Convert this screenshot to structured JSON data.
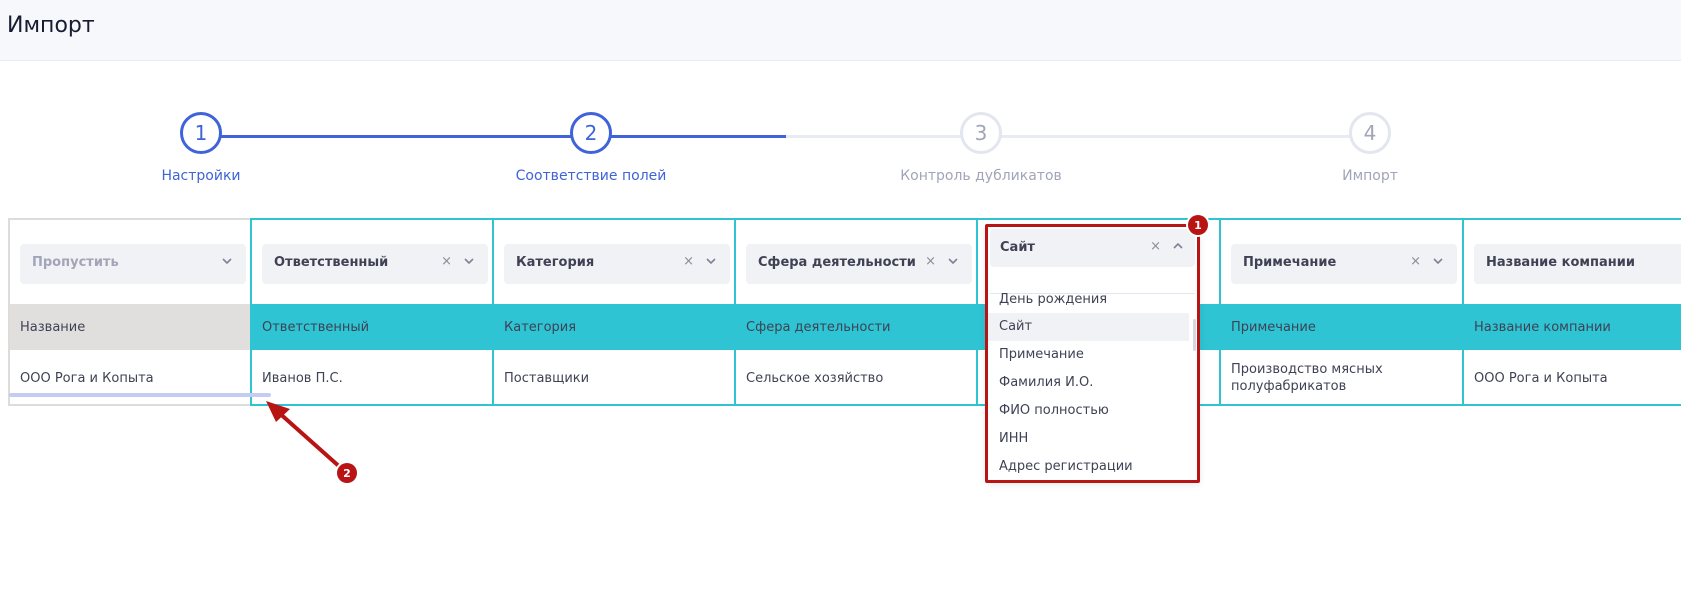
{
  "header": {
    "title": "Импорт"
  },
  "stepper": {
    "steps": [
      {
        "number": "1",
        "label": "Настройки",
        "state": "done"
      },
      {
        "number": "2",
        "label": "Соответствие полей",
        "state": "active"
      },
      {
        "number": "3",
        "label": "Контроль дубликатов",
        "state": "pending"
      },
      {
        "number": "4",
        "label": "Импорт",
        "state": "pending"
      }
    ]
  },
  "columns": [
    {
      "select_value": "Пропустить",
      "header": "Название",
      "value": "ООО Рога и Копыта",
      "skipped": true
    },
    {
      "select_value": "Ответственный",
      "header": "Ответственный",
      "value": "Иванов П.С."
    },
    {
      "select_value": "Категория",
      "header": "Категория",
      "value": "Поставщики"
    },
    {
      "select_value": "Сфера деятельности",
      "header": "Сфера деятельности",
      "value": "Сельское хозяйство"
    },
    {
      "select_value": "Сайт",
      "header": "",
      "value": ""
    },
    {
      "select_value": "Примечание",
      "header": "Примечание",
      "value": "Производство мясных полуфабрикатов"
    },
    {
      "select_value": "Название компании",
      "header": "Название компании",
      "value": "ООО Рога и Копыта"
    }
  ],
  "dropdown": {
    "value": "Сайт",
    "clear_icon": "×",
    "options": [
      "День рождения",
      "Сайт",
      "Примечание",
      "Фамилия И.О.",
      "ФИО полностью",
      "ИНН",
      "Адрес регистрации"
    ],
    "selected": "Сайт"
  },
  "icons": {
    "clear": "×"
  },
  "annotations": {
    "badge1": "1",
    "badge2": "2"
  },
  "colors": {
    "accent": "#3f63d8",
    "mapped_column": "#2ec4d3",
    "annotation": "#b81414"
  }
}
